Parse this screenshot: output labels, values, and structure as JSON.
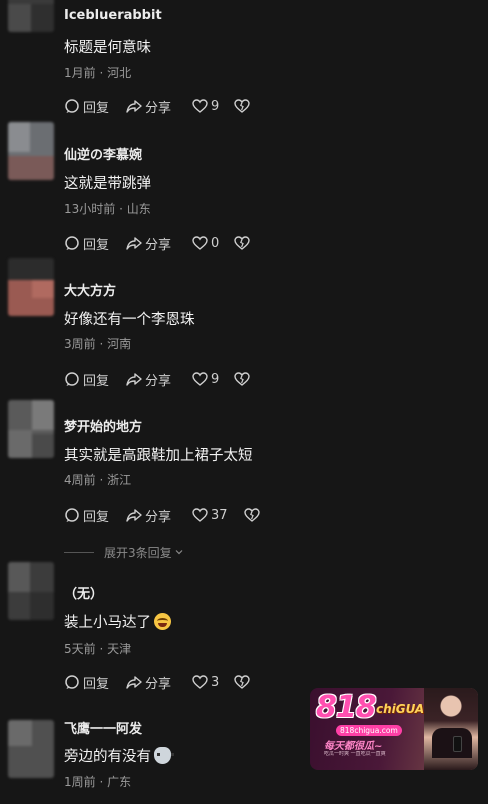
{
  "comments": [
    {
      "username": "Icebluerabbit",
      "text": "标题是何意味",
      "time": "1月前",
      "location": "河北",
      "reply_label": "回复",
      "share_label": "分享",
      "likes": "9",
      "emoji": ""
    },
    {
      "username": "仙逆の李慕婉",
      "text": "这就是带跳弹",
      "time": "13小时前",
      "location": "山东",
      "reply_label": "回复",
      "share_label": "分享",
      "likes": "0",
      "emoji": ""
    },
    {
      "username": "大大方方",
      "text": "好像还有一个李恩珠",
      "time": "3周前",
      "location": "河南",
      "reply_label": "回复",
      "share_label": "分享",
      "likes": "9",
      "emoji": ""
    },
    {
      "username": "梦开始的地方",
      "text": "其实就是高跟鞋加上裙子太短",
      "time": "4周前",
      "location": "浙江",
      "reply_label": "回复",
      "share_label": "分享",
      "likes": "37",
      "emoji": ""
    },
    {
      "username": "（无）",
      "text": "装上小马达了",
      "time": "5天前",
      "location": "天津",
      "reply_label": "回复",
      "share_label": "分享",
      "likes": "3",
      "emoji": "laughing-crying-emoji"
    },
    {
      "username": "飞鹰一一阿发",
      "text": "旁边的有没有",
      "time": "1周前",
      "location": "广东",
      "emoji": "cat-emoji"
    }
  ],
  "expand_replies": "展开3条回复",
  "separator": "·",
  "ad": {
    "brand_number": "818",
    "brand_name": "chiGUA",
    "site": "818chigua.com",
    "slogan": "每天都很瓜~",
    "fine_print": "吃瓜一时爽 一直吃瓜一直爽"
  }
}
